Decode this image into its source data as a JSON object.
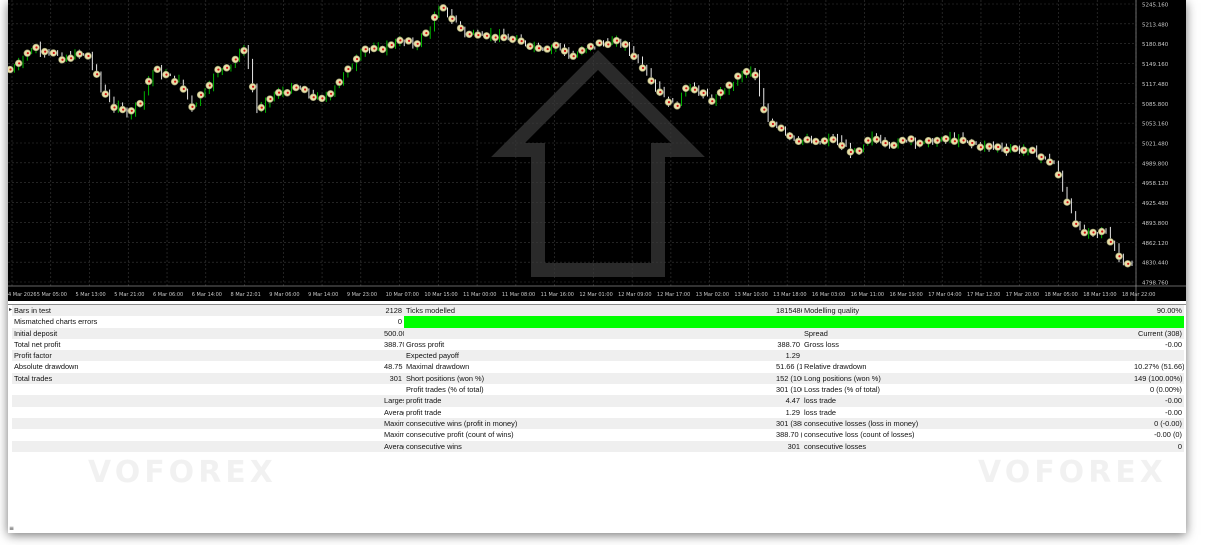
{
  "chart": {
    "price_labels": [
      "5245.160",
      "5213.480",
      "5180.840",
      "5149.160",
      "5117.480",
      "5085.800",
      "5053.160",
      "5021.480",
      "4989.800",
      "4958.120",
      "4925.480",
      "4893.800",
      "4862.120",
      "4830.440",
      "4798.760"
    ],
    "time_labels": [
      "4 Mar 2026",
      "5 Mar 05:00",
      "5 Mar 13:00",
      "5 Mar 21:00",
      "6 Mar 06:00",
      "6 Mar 14:00",
      "8 Mar 22:01",
      "9 Mar 06:00",
      "9 Mar 14:00",
      "9 Mar 23:00",
      "10 Mar 07:00",
      "10 Mar 15:00",
      "11 Mar 00:00",
      "11 Mar 08:00",
      "11 Mar 16:00",
      "12 Mar 01:00",
      "12 Mar 09:00",
      "12 Mar 17:00",
      "13 Mar 02:00",
      "13 Mar 10:00",
      "13 Mar 18:00",
      "16 Mar 03:00",
      "16 Mar 11:00",
      "16 Mar 19:00",
      "17 Mar 04:00",
      "17 Mar 12:00",
      "17 Mar 20:00",
      "18 Mar 05:00",
      "18 Mar 13:00",
      "18 Mar 22:00"
    ],
    "colors": {
      "background": "#000000",
      "grid": "#3a3a3a",
      "bull_candle": "#00c800",
      "bear_candle": "#ffffff",
      "trade_marker": "#e8e0a8",
      "axis_text": "#c8c8c8"
    },
    "price_path": [
      5140,
      5160,
      5175,
      5170,
      5155,
      5165,
      5162,
      5110,
      5080,
      5070,
      5090,
      5140,
      5130,
      5120,
      5080,
      5110,
      5140,
      5150,
      5175,
      5070,
      5095,
      5105,
      5110,
      5100,
      5090,
      5115,
      5140,
      5175,
      5170,
      5180,
      5185,
      5180,
      5200,
      5240,
      5220,
      5195,
      5200,
      5195,
      5190,
      5185,
      5180,
      5175,
      5180,
      5160,
      5170,
      5180,
      5185,
      5180,
      5160,
      5130,
      5100,
      5080,
      5120,
      5100,
      5090,
      5110,
      5130,
      5140,
      5055,
      5050,
      5030,
      5025,
      5020,
      5030,
      5015,
      5005,
      5030,
      5025,
      5020,
      5030,
      5020,
      5025,
      5030,
      5025,
      5020,
      5015,
      5015,
      5012,
      5010,
      5000,
      4990,
      4930,
      4880,
      4875,
      4880,
      4840,
      4825
    ]
  },
  "report": {
    "rows": [
      [
        "Bars in test",
        "2128",
        "Ticks modelled",
        "18154863",
        "Modelling quality",
        "90.00%"
      ],
      [
        "Mismatched charts errors",
        "0",
        "",
        "",
        "",
        ""
      ],
      [
        "Initial deposit",
        "500.00",
        "",
        "",
        "Spread",
        "Current (308)"
      ],
      [
        "Total net profit",
        "388.70",
        "Gross profit",
        "388.70",
        "Gross loss",
        "-0.00"
      ],
      [
        "Profit factor",
        "",
        "Expected payoff",
        "1.29",
        "",
        ""
      ],
      [
        "Absolute drawdown",
        "48.75",
        "Maximal drawdown",
        "51.66 (10.27%)",
        "Relative drawdown",
        "10.27% (51.66)"
      ],
      [
        "Total trades",
        "301",
        "Short positions (won %)",
        "152 (100.00%)",
        "Long positions (won %)",
        "149 (100.00%)"
      ],
      [
        "",
        "",
        "Profit trades (% of total)",
        "301 (100.00%)",
        "Loss trades (% of total)",
        "0 (0.00%)"
      ],
      [
        "",
        "Largest",
        "profit trade",
        "4.47",
        "loss trade",
        "-0.00"
      ],
      [
        "",
        "Average",
        "profit trade",
        "1.29",
        "loss trade",
        "-0.00"
      ],
      [
        "",
        "Maximum",
        "consecutive wins (profit in money)",
        "301 (388.70)",
        "consecutive losses (loss in money)",
        "0 (-0.00)"
      ],
      [
        "",
        "Maximal",
        "consecutive profit (count of wins)",
        "388.70 (301)",
        "consecutive loss (count of losses)",
        "-0.00 (0)"
      ],
      [
        "",
        "Average",
        "consecutive wins",
        "301",
        "consecutive losses",
        "0"
      ]
    ],
    "modelling_quality_fill": 0.9,
    "watermark": "VOFOREX"
  }
}
